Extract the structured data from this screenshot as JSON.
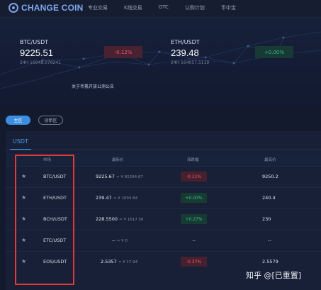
{
  "brand": {
    "logo_text": "CHANGE COIN"
  },
  "nav": {
    "items": [
      "专业交易",
      "K线交易",
      "OTC",
      "认购计划",
      "币中宝"
    ]
  },
  "tickers": [
    {
      "pair": "BTC/USDT",
      "price": "9225.51",
      "volume": "24H 16948.076241",
      "change": "-0.12%",
      "direction": "down"
    },
    {
      "pair": "ETH/USDT",
      "price": "239.48",
      "volume": "24H 164057.5119",
      "change": "+0.00%",
      "direction": "up"
    }
  ],
  "notice": "关于币氪开放公测公告",
  "zones": {
    "main": "主区",
    "innovation": "创新区"
  },
  "market": {
    "tab": "USDT",
    "headers": {
      "market": "市场",
      "latest_price": "最新价",
      "change": "涨跌幅",
      "high": "最高价"
    },
    "rows": [
      {
        "pair": "BTC/USDT",
        "price": "9225.67",
        "cny": "≈ ¥ 65294.67",
        "change": "-0.11%",
        "direction": "down",
        "high": "9250.2"
      },
      {
        "pair": "ETH/USDT",
        "price": "239.47",
        "cny": "≈ ¥ 1694.84",
        "change": "+0.00%",
        "direction": "up",
        "high": "240.4"
      },
      {
        "pair": "BCH/USDT",
        "price": "228.5500",
        "cny": "≈ ¥ 1617.56",
        "change": "+0.27%",
        "direction": "up",
        "high": "230"
      },
      {
        "pair": "ETC/USDT",
        "price": "--",
        "cny": "≈ ¥ 0",
        "change": "--",
        "direction": "none",
        "high": "--"
      },
      {
        "pair": "EOS/USDT",
        "price": "2.5357",
        "cny": "≈ ¥ 17.94",
        "change": "-0.37%",
        "direction": "down",
        "high": "2.5579"
      }
    ]
  },
  "watermark": "知乎 @[已重置]",
  "colors": {
    "up": "#36c48b",
    "down": "#f25d6d",
    "accent": "#3b8ee0",
    "highlight_box": "#e23a3a"
  }
}
